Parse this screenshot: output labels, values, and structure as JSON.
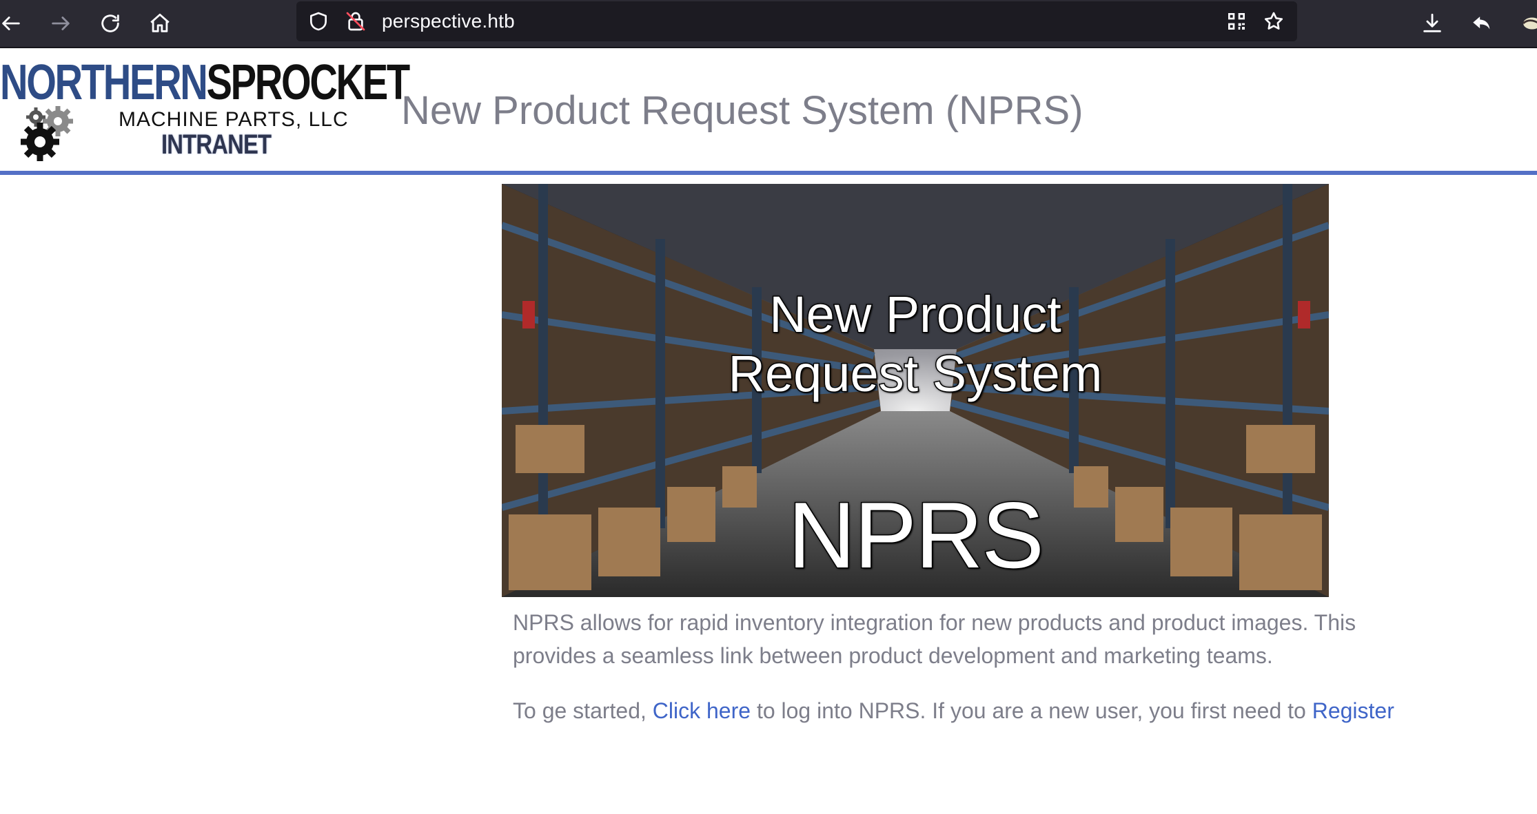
{
  "browser": {
    "url": "perspective.htb",
    "icons": [
      "back-arrow-icon",
      "forward-arrow-icon",
      "reload-icon",
      "home-icon",
      "shield-icon",
      "insecure-lock-icon",
      "qr-code-icon",
      "star-icon",
      "download-icon",
      "share-back-icon",
      "extension-icon"
    ],
    "toolbar_bg": "#2b2a33",
    "urlbar_bg": "#1c1b22"
  },
  "header": {
    "logo": {
      "line1_part1": "NORTHERN",
      "line1_part2": "SPROCKET",
      "line2": "MACHINE PARTS, LLC",
      "line3": "INTRANET"
    },
    "title": "New Product Request System (NPRS)",
    "rule_color": "#5470c6"
  },
  "hero": {
    "line1": "New Product",
    "line2": "Request System",
    "line3": "NPRS"
  },
  "content": {
    "paragraph1": "NPRS allows for rapid inventory integration for new products and product images. This provides a seamless link between product development and marketing teams.",
    "p2_before": "To ge started, ",
    "p2_link1": "Click here",
    "p2_middle": " to log into NPRS. If you are a new user, you first need to ",
    "p2_link2": "Register",
    "text_color": "#7d7e8a",
    "link_color": "#3f65c8"
  }
}
